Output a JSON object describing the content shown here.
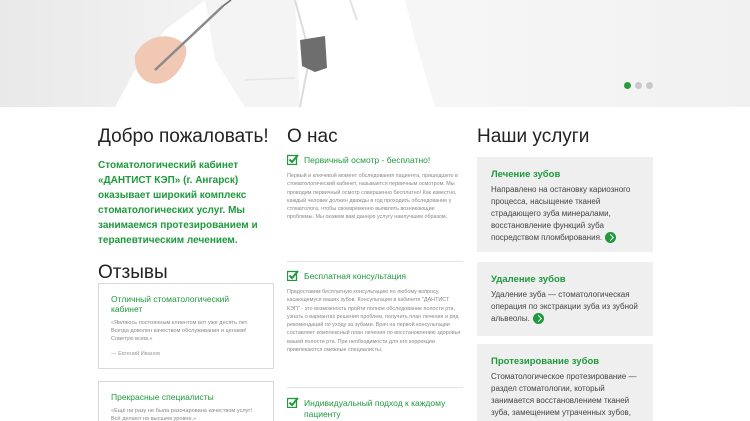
{
  "slider": {
    "slides": 3,
    "active": 1
  },
  "welcome": {
    "title": "Добро пожаловать!",
    "intro": "Стоматологический кабинет «ДАНТИСТ КЭП» (г. Ангарск) оказывает широкий комплекс стоматологических услуг. Мы занимаемся протезированием и терапевтическим лечением."
  },
  "reviews": {
    "title": "Отзывы",
    "items": [
      {
        "title": "Отличный стоматологический кабинет",
        "text": "«Являюсь постоянным клиентом вот уже десять лет. Всегда доволен качеством обслуживания и ценами! Советую всем.»",
        "author": "— Евгений Иванов"
      },
      {
        "title": "Прекрасные специалисты",
        "text": "«Ещё ни разу не была разочарована качеством услуг! Всё делают на высшем уровне.»",
        "author": ""
      }
    ]
  },
  "about": {
    "title": "О нас",
    "items": [
      {
        "title": "Первичный осмотр - бесплатно!",
        "text": "Первый и ключевой момент обследования пациента, пришедшего в стоматологический кабинет, называется первичным осмотром. Мы проводим первичный осмотр совершенно бесплатно! Как известно, каждый человек должен дважды в год проходить обследование у стоматолога, чтобы своевременно выявлять возникающие проблемы. Мы окажем вам данную услугу наилучшим образом."
      },
      {
        "title": "Бесплатная консультация",
        "text": "Предоставим бесплатную консультацию по любому вопросу, касающемуся ваших зубов. Консультация в кабинете \"ДАНТИСТ КЭП\" - это возможность пройти полное обследование полости рта, узнать о вариантах решения проблем, получить план лечения и ряд рекомендаций по уходу за зубами. Врач на первой консультации составляет комплексный план лечения по восстановлению здоровья вашей полости рта. При необходимости для его коррекции привлекаются смежные специалисты."
      },
      {
        "title": "Индивидуальный подход к каждому пациенту",
        "text": ""
      }
    ]
  },
  "services": {
    "title": "Наши услуги",
    "items": [
      {
        "title": "Лечение зубов",
        "text": "Направлено на остановку кариозного процесса, насыщение тканей страдающего зуба минералами, восстановление функций зуба посредством пломбирования."
      },
      {
        "title": "Удаление зубов",
        "text": "Удаление зуба — стоматологическая операция по экстракции зуба из зубной альвеолы."
      },
      {
        "title": "Протезирование зубов",
        "text": "Стоматологическое протезирование — раздел стоматологии, который занимается восстановлением тканей зуба, замещением утраченных зубов, восстановлением структуры и"
      }
    ]
  },
  "colors": {
    "accent": "#1e9a3c",
    "card": "#efefef"
  }
}
